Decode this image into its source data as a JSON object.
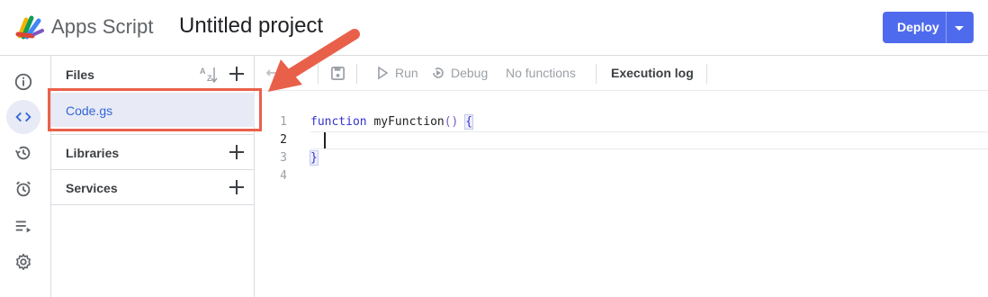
{
  "header": {
    "app_name": "Apps Script",
    "project_title": "Untitled project",
    "deploy_label": "Deploy"
  },
  "rail": {
    "items": [
      {
        "icon": "info-icon",
        "active": false
      },
      {
        "icon": "code-icon",
        "active": true
      },
      {
        "icon": "history-icon",
        "active": false
      },
      {
        "icon": "alarm-icon",
        "active": false
      },
      {
        "icon": "executions-icon",
        "active": false
      },
      {
        "icon": "settings-icon",
        "active": false
      }
    ]
  },
  "files_panel": {
    "files_label": "Files",
    "file_name": "Code.gs",
    "libraries_label": "Libraries",
    "services_label": "Services"
  },
  "toolbar": {
    "run_label": "Run",
    "debug_label": "Debug",
    "function_select": "No functions",
    "execution_log_label": "Execution log"
  },
  "editor": {
    "lines": [
      {
        "num": "1",
        "code": "function myFunction() {"
      },
      {
        "num": "2",
        "code": ""
      },
      {
        "num": "3",
        "code": "}"
      },
      {
        "num": "4",
        "code": ""
      }
    ]
  },
  "colors": {
    "accent": "#4f6bed",
    "annotation": "#e9604a",
    "selected_bg": "#e8eaf6"
  }
}
